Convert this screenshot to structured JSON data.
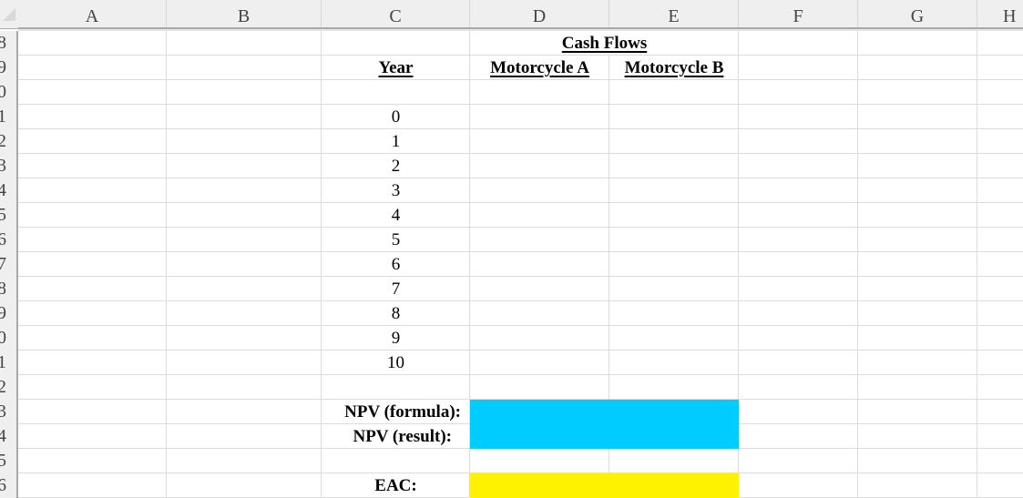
{
  "columns": [
    "A",
    "B",
    "C",
    "D",
    "E",
    "F",
    "G",
    "H"
  ],
  "rows": [
    "8",
    "9",
    "0",
    "1",
    "2",
    "3",
    "4",
    "5",
    "6",
    "7",
    "8",
    "9",
    "0",
    "1",
    "2",
    "3",
    "4",
    "5",
    "6"
  ],
  "sheet": {
    "cash_flows_header": "Cash Flows",
    "year_header": "Year",
    "motorcycle_a_header": "Motorcycle A",
    "motorcycle_b_header": "Motorcycle B",
    "years": [
      "0",
      "1",
      "2",
      "3",
      "4",
      "5",
      "6",
      "7",
      "8",
      "9",
      "10"
    ],
    "npv_formula_label": "NPV (formula):",
    "npv_result_label": "NPV (result):",
    "eac_label": "EAC:"
  },
  "colors": {
    "npv_fill": "#00ccff",
    "eac_fill": "#ffef00",
    "header_bg": "#efefef",
    "gridline": "#dcdcdc"
  }
}
